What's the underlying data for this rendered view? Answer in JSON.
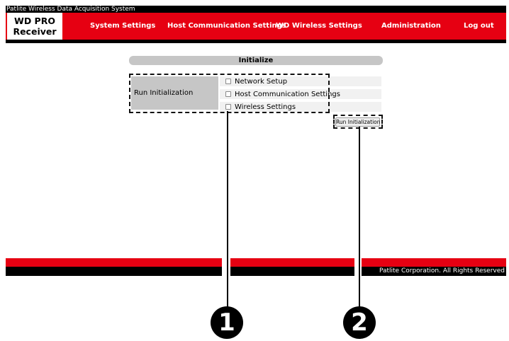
{
  "window": {
    "title": "Patlite Wireless Data Acquisition System"
  },
  "brand": {
    "line1": "WD PRO",
    "line2": "Receiver"
  },
  "nav": {
    "items": [
      {
        "label": "System Settings"
      },
      {
        "label": "Host Communication Settings"
      },
      {
        "label": "WD Wireless Settings"
      },
      {
        "label": "Administration"
      },
      {
        "label": "Log out"
      }
    ]
  },
  "section": {
    "title": "Initialize"
  },
  "initialize": {
    "row_label": "Run Initialization",
    "options": [
      {
        "label": "Network Setup",
        "checked": false
      },
      {
        "label": "Host Communication Settings",
        "checked": false
      },
      {
        "label": "Wireless Settings",
        "checked": false
      }
    ],
    "button_label": "Run Initialization"
  },
  "footer": {
    "copyright": "Patlite Corporation. All Rights Reserved"
  },
  "callouts": [
    "1",
    "2"
  ],
  "colors": {
    "nav_red": "#e60012",
    "header_gray": "#c6c6c6",
    "black": "#000000"
  }
}
